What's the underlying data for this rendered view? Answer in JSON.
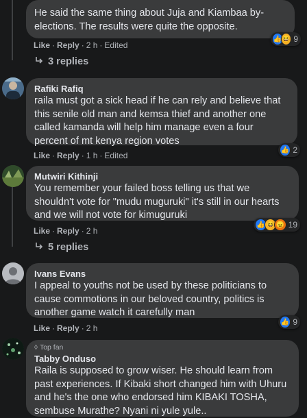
{
  "colors": {
    "background": "#18191a",
    "bubble": "#3a3b3c",
    "text": "#e4e6eb",
    "muted": "#b0b3b8",
    "like": "#2078f4",
    "haha": "#f7b125",
    "angry": "#e9710f"
  },
  "comments": [
    {
      "name": "",
      "text_lines": [
        "He said the same thing about Juja and Kiambaa by-",
        "elections. The results were quite the opposite."
      ],
      "like": "Like",
      "reply": "Reply",
      "time": "2 h",
      "edited": "Edited",
      "reactions": [
        "like-icon",
        "haha-icon"
      ],
      "reaction_count": "9",
      "replies": "3 replies"
    },
    {
      "name": "Rafiki Rafiq",
      "text_lines": [
        "raila must got a sick head if he can rely and believe that",
        "this senile old man and kemsa thief and another one",
        "called kamanda will help him manage even a four",
        "percent of mt kenya region votes"
      ],
      "like": "Like",
      "reply": "Reply",
      "time": "1 h",
      "edited": "Edited",
      "reactions": [
        "like-icon"
      ],
      "reaction_count": "2"
    },
    {
      "name": "Mutwiri Kithinji",
      "text_lines": [
        "You remember your failed boss telling us that we",
        "shouldn't vote for \"mudu muguruki\" it's still in our hearts",
        "and we will not vote for kimuguruki"
      ],
      "like": "Like",
      "reply": "Reply",
      "time": "2 h",
      "reactions": [
        "like-icon",
        "haha-icon",
        "angry-icon"
      ],
      "reaction_count": "19",
      "replies": "5 replies"
    },
    {
      "name": "Ivans Evans",
      "text_lines": [
        "I appeal to youths not be used by these politicians to",
        "cause commotions in our beloved country, politics is",
        "another game watch it carefully man"
      ],
      "like": "Like",
      "reply": "Reply",
      "time": "2 h",
      "reactions": [
        "like-icon"
      ],
      "reaction_count": "9"
    },
    {
      "badge": "Top fan",
      "name": "Tabby Onduso",
      "text_lines": [
        "Raila is supposed to grow wiser. He should learn from",
        "past experiences. If Kibaki short changed him with Uhuru",
        "and he's the one who endorsed him KIBAKI TOSHA,",
        "sembuse Murathe? Nyani ni yule yule.."
      ]
    }
  ]
}
